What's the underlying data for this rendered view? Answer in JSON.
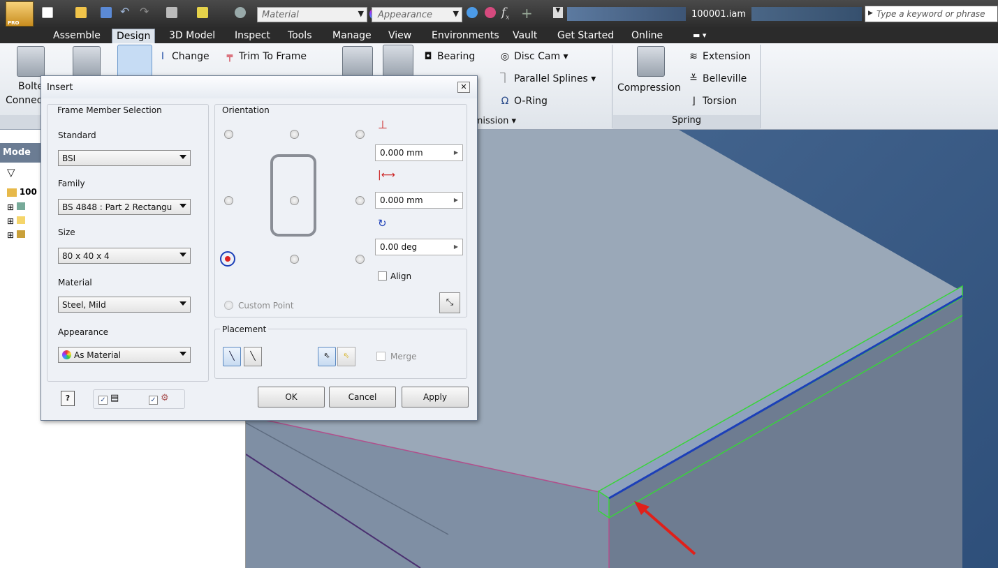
{
  "app": {
    "material_combo": "Material",
    "appearance_combo": "Appearance",
    "fx_glyph": "f",
    "document_title": "100001.iam",
    "search_placeholder": "Type a keyword or phrase",
    "pro_badge": "PRO"
  },
  "menu_tabs": [
    "Assemble",
    "Design",
    "3D Model",
    "Inspect",
    "Tools",
    "Manage",
    "View",
    "Environments",
    "Vault",
    "Get Started",
    "Online"
  ],
  "active_tab": "Design",
  "ribbon": {
    "bolted_label_1": "Bolte",
    "bolted_label_2": "Connec",
    "change": "Change",
    "trim_to_frame": "Trim To Frame",
    "bearing": "Bearing",
    "disc_cam": "Disc Cam",
    "parallel_splines": "Parallel Splines",
    "o_ring": "O-Ring",
    "compression": "Compression",
    "extension": "Extension",
    "belleville": "Belleville",
    "torsion": "Torsion",
    "power_transmission_partial": "smission",
    "spring_panel": "Spring"
  },
  "browser": {
    "header": "Mode",
    "root_item": "100"
  },
  "dialog": {
    "title": "Insert",
    "frame_member_selection": "Frame Member Selection",
    "standard_label": "Standard",
    "standard_value": "BSI",
    "family_label": "Family",
    "family_value": "BS 4848 : Part 2 Rectangu",
    "size_label": "Size",
    "size_value": "80 x 40 x 4",
    "material_label": "Material",
    "material_value": "Steel, Mild",
    "appearance_label": "Appearance",
    "appearance_value": "As Material",
    "orientation": "Orientation",
    "offset1": "0.000 mm",
    "offset2": "0.000 mm",
    "rotation": "0.00 deg",
    "align": "Align",
    "custom_point": "Custom Point",
    "placement": "Placement",
    "merge": "Merge",
    "ok": "OK",
    "cancel": "Cancel",
    "apply": "Apply",
    "help_glyph": "?"
  },
  "colors": {
    "accent_red": "#e0201a",
    "edge_green": "#38d43a",
    "edge_blue": "#1c3fb8",
    "edge_magenta": "#b0508c"
  }
}
